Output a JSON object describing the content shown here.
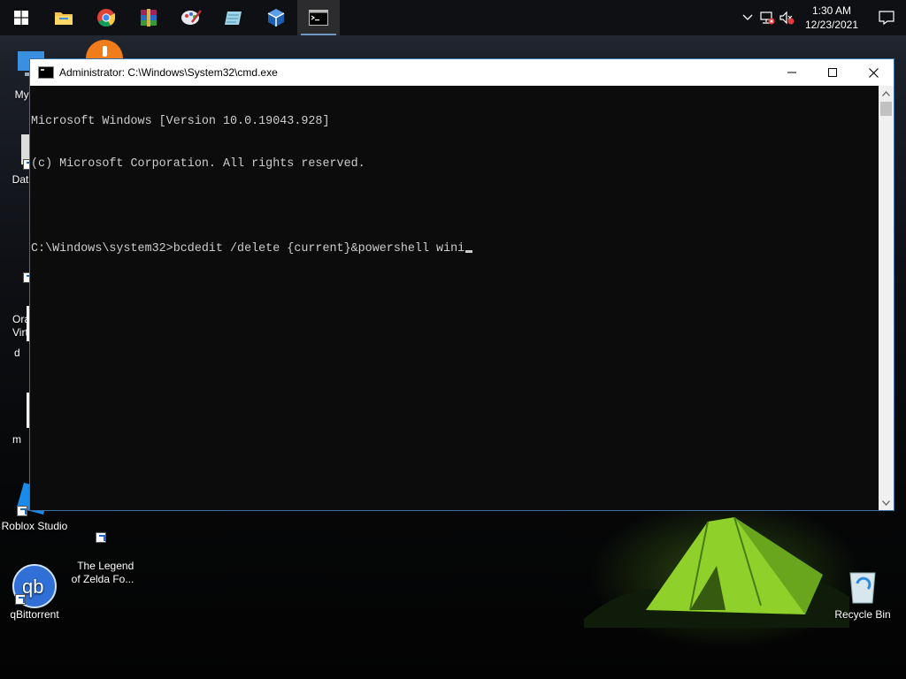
{
  "taskbar": {
    "apps": [
      {
        "name": "start",
        "icon": "windows-logo-icon"
      },
      {
        "name": "file-explorer",
        "icon": "folder-icon"
      },
      {
        "name": "chrome",
        "icon": "chrome-icon"
      },
      {
        "name": "winrar",
        "icon": "winrar-icon"
      },
      {
        "name": "paint-app",
        "icon": "palette-icon"
      },
      {
        "name": "notes-app",
        "icon": "notepad-icon"
      },
      {
        "name": "virtualbox",
        "icon": "virtualbox-icon"
      },
      {
        "name": "cmd",
        "icon": "terminal-icon"
      }
    ],
    "clock_time": "1:30 AM",
    "clock_date": "12/23/2021"
  },
  "desktop": {
    "icons": [
      {
        "label": "My Co"
      },
      {
        "label": "DataW"
      },
      {
        "label": "Orac\nVirtu"
      },
      {
        "label": "d"
      },
      {
        "label": "m"
      },
      {
        "label": "Roblox Studio"
      },
      {
        "label": "The Legend\nof Zelda Fo..."
      },
      {
        "label": "qBittorrent"
      },
      {
        "label": "Recycle Bin"
      }
    ]
  },
  "cmd": {
    "title": "Administrator: C:\\Windows\\System32\\cmd.exe",
    "lines": [
      "Microsoft Windows [Version 10.0.19043.928]",
      "(c) Microsoft Corporation. All rights reserved.",
      "",
      "C:\\Windows\\system32>bcdedit /delete {current}&powershell wini"
    ]
  },
  "colors": {
    "console_bg": "#0c0c0c",
    "console_text": "#cccccc",
    "taskbar_bg": "#0f1013",
    "tent_green": "#8fd12a"
  }
}
